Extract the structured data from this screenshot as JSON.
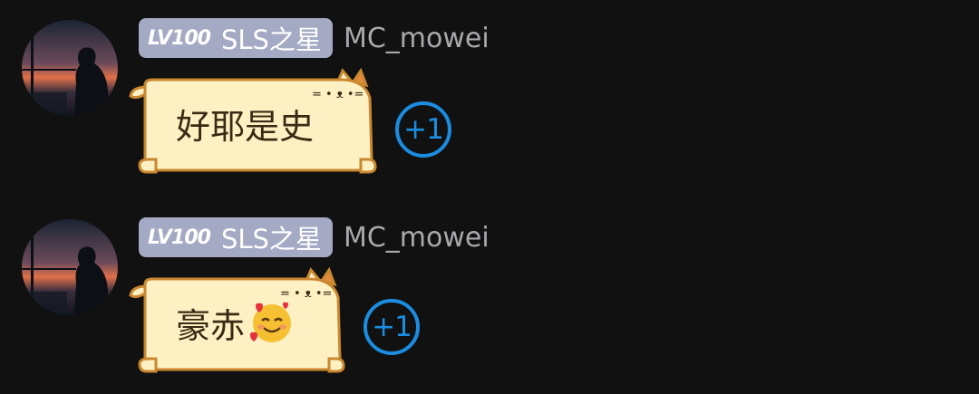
{
  "messages": [
    {
      "level": "LV100",
      "title": "SLS之星",
      "username": "MC_mowei",
      "text": "好耶是史",
      "emoji": "",
      "reaction": "+1"
    },
    {
      "level": "LV100",
      "title": "SLS之星",
      "username": "MC_mowei",
      "text": "豪赤",
      "emoji": "smiling-face-with-hearts",
      "reaction": "+1"
    }
  ],
  "colors": {
    "background": "#111111",
    "badge": "#a4a9c4",
    "username": "#a9a9ad",
    "bubble_fill": "#fdf1c4",
    "bubble_border": "#c9882f",
    "reaction": "#1b8de0"
  }
}
